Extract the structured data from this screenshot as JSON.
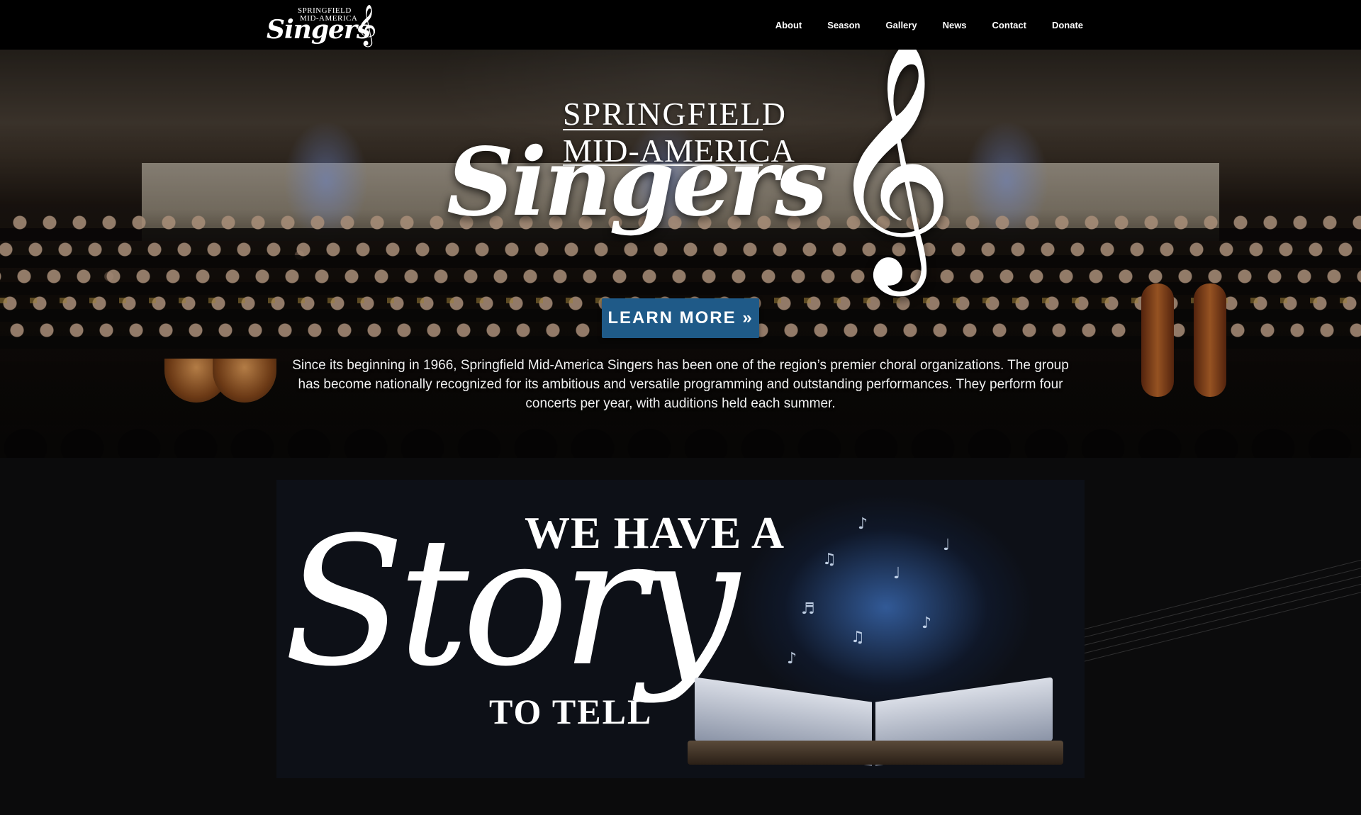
{
  "nav": {
    "logo": {
      "line1": "SPRINGFIELD",
      "line2": "MID-AMERICA",
      "line3": "Singers",
      "clef_icon": "treble-clef-icon"
    },
    "links": [
      "About",
      "Season",
      "Gallery",
      "News",
      "Contact",
      "Donate"
    ]
  },
  "hero": {
    "logo": {
      "line1": "SPRINGFIELD",
      "line2": "MID-AMERICA",
      "line3": "Singers",
      "clef_icon": "treble-clef-icon"
    },
    "button_label": "LEARN MORE »",
    "description": "Since its beginning in 1966, Springfield Mid-America Singers has been one of the region’s premier choral organizations. The group has become nationally recognized for its ambitious and versatile programming and outstanding performances. They perform four concerts per year, with auditions held each summer."
  },
  "banner": {
    "line1": "WE HAVE A",
    "line2": "Story",
    "line3": "TO TELL",
    "image": "open-book-with-music-notes"
  },
  "colors": {
    "nav_bg": "#000000",
    "button_bg": "#1f5a88",
    "page_bg": "#0b0b0c"
  }
}
